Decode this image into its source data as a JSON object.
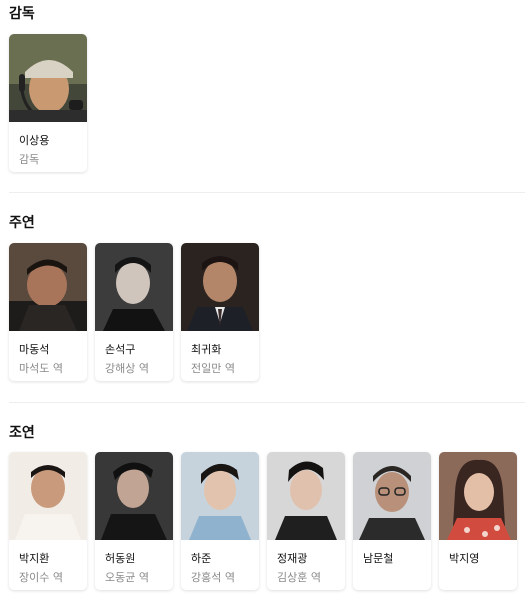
{
  "sections": {
    "director": {
      "title": "감독",
      "people": [
        {
          "name": "이상용",
          "role": "감독"
        }
      ]
    },
    "lead": {
      "title": "주연",
      "people": [
        {
          "name": "마동석",
          "role": "마석도 역"
        },
        {
          "name": "손석구",
          "role": "강해상 역"
        },
        {
          "name": "최귀화",
          "role": "전일만 역"
        }
      ]
    },
    "supporting": {
      "title": "조연",
      "people": [
        {
          "name": "박지환",
          "role": "장이수 역"
        },
        {
          "name": "허동원",
          "role": "오동균 역"
        },
        {
          "name": "하준",
          "role": "강홍석 역"
        },
        {
          "name": "정재광",
          "role": "김상훈 역"
        },
        {
          "name": "남문철",
          "role": ""
        },
        {
          "name": "박지영",
          "role": ""
        }
      ]
    }
  },
  "colors": {
    "title": "#111111",
    "role_text": "#8a8a8a",
    "divider": "#eeeeee"
  }
}
